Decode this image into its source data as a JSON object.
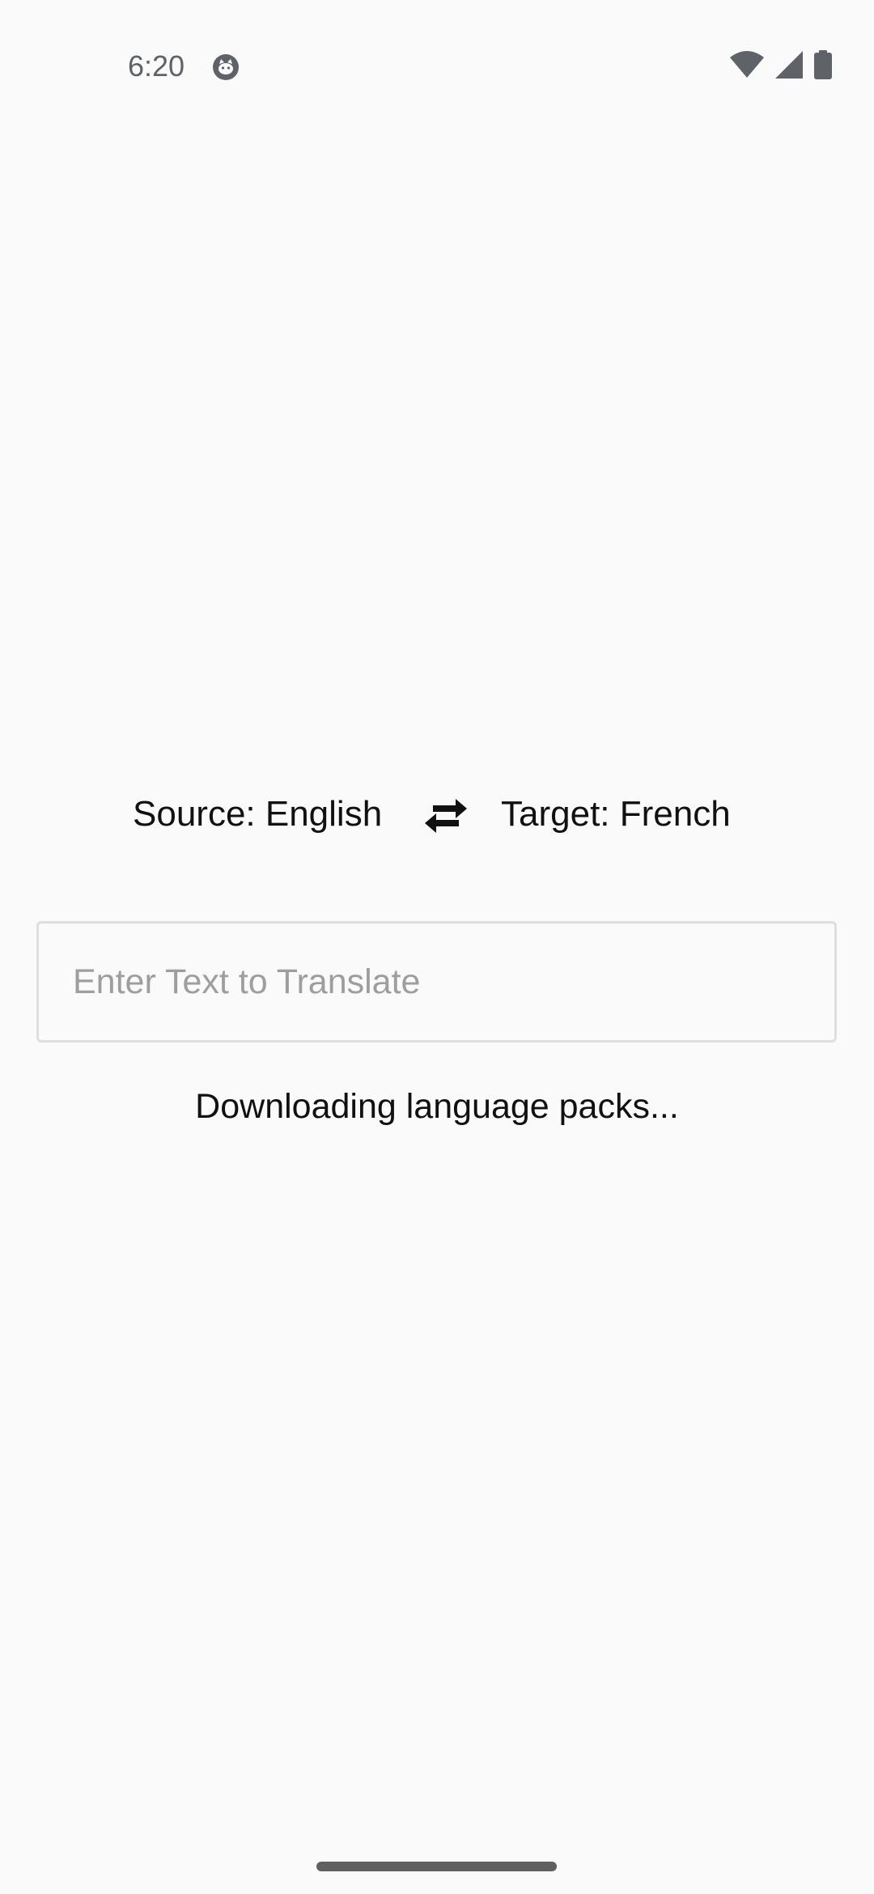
{
  "status_bar": {
    "time": "6:20",
    "app_icon": "cat-face-icon",
    "wifi_icon": "wifi-icon",
    "signal_icon": "cell-signal-icon",
    "battery_icon": "battery-icon"
  },
  "language_row": {
    "source_label": "Source: English",
    "swap_icon": "swap-arrows-icon",
    "target_label": "Target: French"
  },
  "input": {
    "value": "",
    "placeholder": "Enter Text to Translate"
  },
  "status_message": "Downloading language packs...",
  "colors": {
    "background": "#fafafa",
    "text": "#111111",
    "placeholder": "#9e9e9e",
    "input_border": "#dedede",
    "status_icons": "#5f6368"
  }
}
